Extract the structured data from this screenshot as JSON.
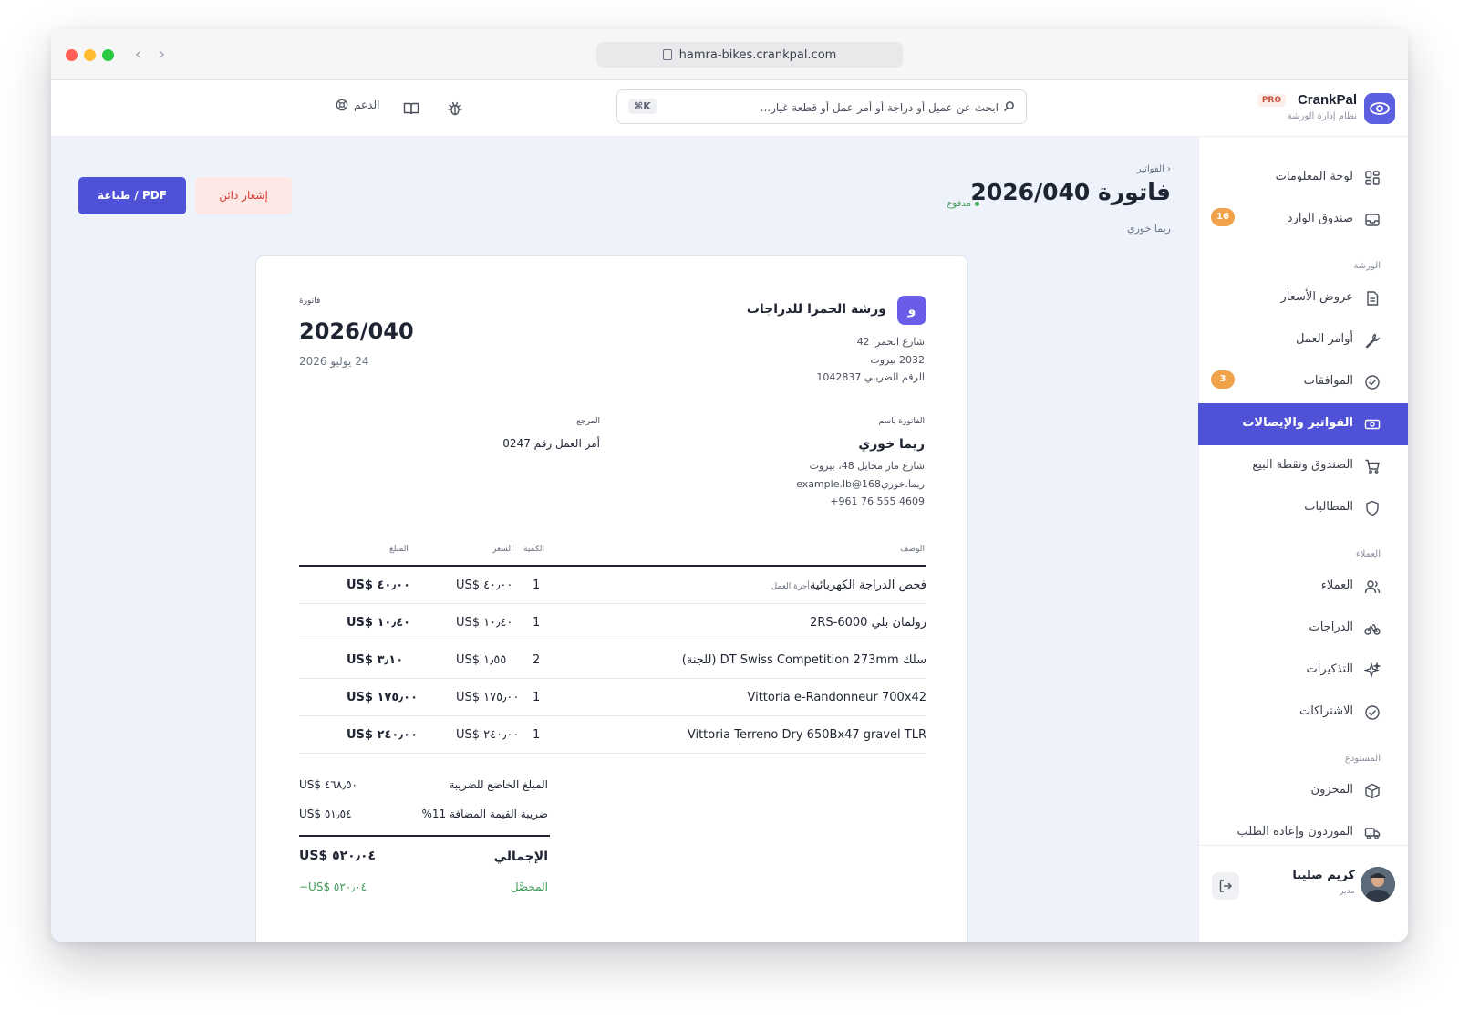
{
  "browser": {
    "url": "hamra-bikes.crankpal.com"
  },
  "topbar": {
    "brand_name": "CrankPal",
    "brand_badge": "PRO",
    "brand_subtitle": "نظام إدارة الورشة",
    "search_placeholder": "ابحث عن عميل أو دراجة أو أمر عمل أو قطعة غيار...",
    "search_shortcut": "⌘K",
    "support_label": "الدعم"
  },
  "sidebar": {
    "items": [
      {
        "label": "لوحة المعلومات",
        "icon": "dashboard-grid-icon"
      },
      {
        "label": "صندوق الوارد",
        "icon": "inbox-icon",
        "badge": "16"
      },
      {
        "label": "عروض الأسعار",
        "icon": "document-icon"
      },
      {
        "label": "أوامر العمل",
        "icon": "wrench-icon"
      },
      {
        "label": "الموافقات",
        "icon": "check-circle-icon",
        "badge": "3"
      },
      {
        "label": "الفواتير والإيصالات",
        "icon": "banknote-icon",
        "active": true
      },
      {
        "label": "الصندوق ونقطة البيع",
        "icon": "cart-icon"
      },
      {
        "label": "المطالبات",
        "icon": "shield-icon"
      },
      {
        "label": "العملاء",
        "icon": "users-icon"
      },
      {
        "label": "الدراجات",
        "icon": "bike-icon"
      },
      {
        "label": "التذكيرات",
        "icon": "sparkle-icon"
      },
      {
        "label": "الاشتراكات",
        "icon": "check-circle-icon"
      },
      {
        "label": "المخزون",
        "icon": "box-icon"
      },
      {
        "label": "الموردون وإعادة الطلب",
        "icon": "truck-icon"
      }
    ],
    "sections": {
      "workshop": "الورشة",
      "customers": "العملاء",
      "warehouse": "المستودع"
    },
    "user": {
      "name": "كريم صليبا",
      "role": "مدير"
    }
  },
  "page": {
    "breadcrumb": "‹ الفواتير",
    "title": "فاتورة 2026/040",
    "status": "مدفوع",
    "customer": "ريما خوري",
    "actions": {
      "print": "طباعة / PDF",
      "credit_note": "إشعار دائن"
    }
  },
  "invoice": {
    "shop": {
      "logo_letter": "و",
      "name": "ورشة الحمرا للدراجات",
      "address_line1": "شارع الحمرا 42",
      "address_line2": "2032 بيروت",
      "tax_id": "الرقم الضريبي 1042837"
    },
    "label": "فاتورة",
    "number": "2026/040",
    "date": "24 يوليو 2026",
    "bill_to": {
      "label": "الفاتورة باسم",
      "name": "ريما خوري",
      "address": "شارع مار مخايل 48، بيروت",
      "email": "ريما.خوري168@example.lb",
      "phone": "+961 76 555 4609"
    },
    "reference": {
      "label": "المرجع",
      "value": "أمر العمل رقم 0247"
    },
    "columns": {
      "description": "الوصف",
      "qty": "الكمية",
      "price": "السعر",
      "amount": "المبلغ"
    },
    "lines": [
      {
        "tag": "أجرة العمل",
        "description": "فحص الدراجة الكهربائية",
        "qty": "1",
        "price": "US$ ٤٠٫٠٠",
        "amount": "US$ ٤٠٫٠٠"
      },
      {
        "tag": "",
        "description": "رولمان بلي 2RS-6000",
        "qty": "1",
        "price": "US$ ١٠٫٤٠",
        "amount": "US$ ١٠٫٤٠"
      },
      {
        "tag": "",
        "description": "سلك DT Swiss Competition 273mm (للجنة)",
        "qty": "2",
        "price": "US$ ١٫٥٥",
        "amount": "US$ ٣٫١٠"
      },
      {
        "tag": "",
        "description": "Vittoria e-Randonneur 700x42",
        "qty": "1",
        "price": "US$ ١٧٥٫٠٠",
        "amount": "US$ ١٧٥٫٠٠"
      },
      {
        "tag": "",
        "description": "Vittoria Terreno Dry 650Bx47 gravel TLR",
        "qty": "1",
        "price": "US$ ٢٤٠٫٠٠",
        "amount": "US$ ٢٤٠٫٠٠"
      }
    ],
    "totals": {
      "taxable_label": "المبلغ الخاضع للضريبة",
      "taxable_value": "US$ ٤٦٨٫٥٠",
      "vat_label": "ضريبة القيمة المضافة 11%",
      "vat_value": "US$ ٥١٫٥٤",
      "total_label": "الإجمالي",
      "total_value": "US$ ٥٢٠٫٠٤",
      "paid_label": "المحصَّل",
      "paid_value": "−US$ ٥٢٠٫٠٤"
    }
  },
  "colors": {
    "accent": "#4f52d6",
    "paid_green": "#3f9b56",
    "danger": "#d63a31",
    "badge_orange": "#f0a24a"
  }
}
